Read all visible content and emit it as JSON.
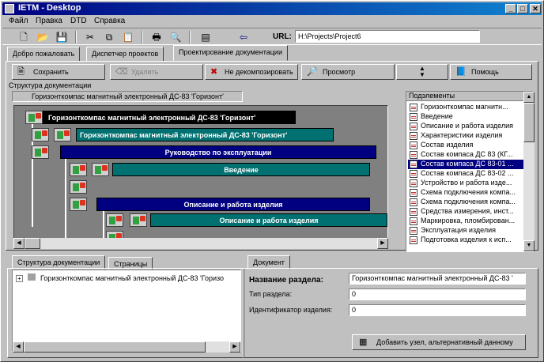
{
  "window": {
    "title": "IETM - Desktop",
    "min": "_",
    "max": "□",
    "close": "✕"
  },
  "menu": [
    "Файл",
    "Правка",
    "DTD",
    "Справка"
  ],
  "toolbar": {
    "url_label": "URL:",
    "url_value": "H:\\Projects\\Project6"
  },
  "top_tabs": [
    "Добро пожаловать",
    "Диспетчер проектов",
    "Проектирование документации"
  ],
  "actions": {
    "save": "Сохранить",
    "delete": "Удалить",
    "not_decompose": "Не декомпозировать",
    "preview": "Просмотр",
    "help": "Помощь"
  },
  "structure": {
    "group_label": "Структура документации",
    "breadcrumb": "Горизонткомпас магнитный электронный ДС-83 'Горизонт'",
    "nodes": [
      "Горизонткомпас магнитный электронный ДС-83 'Горизонт'",
      "Горизонткомпас магнитный электронный ДС-83 'Горизонт'",
      "Руководство по эксплуатации",
      "Введение",
      "Описание и работа изделия",
      "Описание и работа изделия"
    ]
  },
  "subelements": {
    "header": "Подэлементы",
    "items": [
      "Горизонткомпас магнитн...",
      "Введение",
      "Описание и работа изделия",
      "Характеристики изделия",
      "Состав изделия",
      "Состав компаса ДС 83 (КГ...",
      "Состав компаса ДС 83-01 ...",
      "Состав компаса ДС 83-02 ...",
      "Устройство и работа изде...",
      "Схема подключения компа...",
      "Схема подключения компа...",
      "Средства измерения, инст...",
      "Маркировка, пломбирован...",
      "Эксплуатация изделия",
      "Подготовка изделия к исп..."
    ],
    "selected_index": 6
  },
  "bottom_left": {
    "tabs": [
      "Структура документации",
      "Страницы"
    ],
    "tree_root": "Горизонткомпас магнитный электронный ДС-83 'Горизо"
  },
  "bottom_right": {
    "tab": "Документ",
    "section_name_label": "Название раздела:",
    "section_name_value": "Горизонткомпас магнитный электронный ДС-83 '",
    "section_type_label": "Тип раздела:",
    "section_type_value": "0",
    "product_id_label": "Идентификатор изделия:",
    "product_id_value": "0",
    "add_node_button": "Добавить узел, альтернативный данному"
  }
}
